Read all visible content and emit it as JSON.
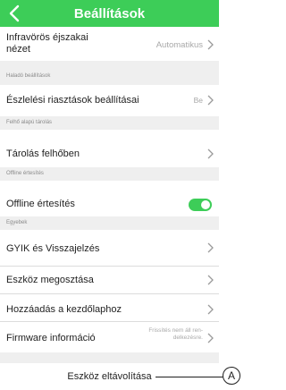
{
  "header": {
    "title": "Beállítások",
    "back_icon": "chevron-left-icon"
  },
  "rows": {
    "infrared_label": "Infravörös éjszakai nézet",
    "infrared_line1": "Infravörös éjszakai",
    "infrared_line2": "nézet",
    "infrared_value": "Automatikus",
    "advanced_section": "Haladó beállítások",
    "detection_label": "Észlelési riasztások beállításai",
    "detection_value": "Be",
    "cloud_section": "Felhő alapú tárolás",
    "cloud_label": "Tárolás felhőben",
    "offline_section": "Offline értesítés",
    "offline_label": "Offline értesítés",
    "offline_toggle_on": true,
    "other_section": "Egyebek",
    "faq_label": "GYIK és Visszajelzés",
    "share_label": "Eszköz megosztása",
    "home_label": "Hozzáadás a kezdőlaphoz",
    "firmware_label": "Firmware információ",
    "firmware_value_line1": "Frissítés nem áll ren-",
    "firmware_value_line2": "delkezésre.",
    "remove_label": "Eszköz eltávolítása"
  },
  "callout": {
    "letter": "A"
  },
  "colors": {
    "accent": "#3dcd58",
    "background": "#efefef",
    "text": "#1f1f1f",
    "muted": "#a8a8a8"
  }
}
